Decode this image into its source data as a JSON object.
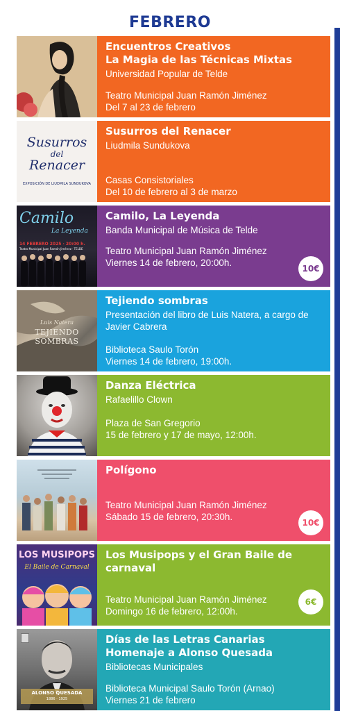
{
  "month": "FEBRERO",
  "events": [
    {
      "title_lines": [
        "Encuentros Creativos",
        "La Magia de las Técnicas Mixtas"
      ],
      "subtitle_lines": [
        "Universidad Popular de Telde"
      ],
      "venue": "Teatro Municipal Juan Ramón Jiménez",
      "date": "Del 7 al 23 de febrero",
      "price": "",
      "color": "#f26722"
    },
    {
      "title_lines": [
        "Susurros del Renacer"
      ],
      "subtitle_lines": [
        "Liudmila Sundukova"
      ],
      "venue": "Casas Consistoriales",
      "date": "Del 10 de febrero al 3 de marzo",
      "price": "",
      "color": "#f26722",
      "thumb_text": [
        "Susurros",
        "del",
        "Renacer",
        "EXPOSICIÓN DE LIUDMILA SUNDUKOVA"
      ]
    },
    {
      "title_lines": [
        "Camilo, La Leyenda"
      ],
      "subtitle_lines": [
        "Banda Municipal de Música de Telde"
      ],
      "venue": "Teatro Municipal Juan Ramón Jiménez",
      "date": "Viernes 14 de febrero, 20:00h.",
      "price": "10€",
      "color": "#7a3c8f",
      "thumb_text": [
        "Camilo",
        "La Leyenda",
        "14 FEBRERO 2025 · 20:00 h.",
        "Teatro Municipal Juan Ramón Jiménez · TELDE"
      ]
    },
    {
      "title_lines": [
        "Tejiendo sombras"
      ],
      "subtitle_lines": [
        "Presentación del libro de Luis Natera, a cargo de",
        "Javier Cabrera"
      ],
      "venue": "Biblioteca Saulo Torón",
      "date": "Viernes 14 de febrero, 19:00h.",
      "price": "",
      "color": "#1aa3dd",
      "thumb_text": [
        "Luis Natera",
        "TEJIENDO SOMBRAS"
      ]
    },
    {
      "title_lines": [
        "Danza Eléctrica"
      ],
      "subtitle_lines": [
        "Rafaelillo Clown"
      ],
      "venue": "Plaza de San Gregorio",
      "date": "15 de febrero y 17 de mayo, 12:00h.",
      "price": "",
      "color": "#8cb930"
    },
    {
      "title_lines": [
        "Polígono"
      ],
      "subtitle_lines": [],
      "venue": "Teatro Municipal Juan Ramón Jiménez",
      "date": "Sábado 15 de febrero, 20:30h.",
      "price": "10€",
      "color": "#ef4f6b"
    },
    {
      "title_lines": [
        "Los Musipops y el Gran Baile de",
        "carnaval"
      ],
      "subtitle_lines": [],
      "venue": "Teatro Municipal Juan Ramón Jiménez",
      "date": "Domingo 16 de febrero, 12:00h.",
      "price": "6€",
      "color": "#8cb930",
      "thumb_text": [
        "LOS MUSIPOPS",
        "El Baile de Carnaval"
      ]
    },
    {
      "title_lines": [
        "Días de las Letras Canarias",
        "Homenaje a Alonso Quesada"
      ],
      "subtitle_lines": [
        "Bibliotecas Municipales"
      ],
      "venue": "Biblioteca Municipal Saulo Torón (Arnao)",
      "date": "Viernes 21 de febrero",
      "price": "",
      "color": "#23a7b5",
      "thumb_text": [
        "ALONSO QUESADA",
        "1886 - 1925"
      ]
    }
  ]
}
